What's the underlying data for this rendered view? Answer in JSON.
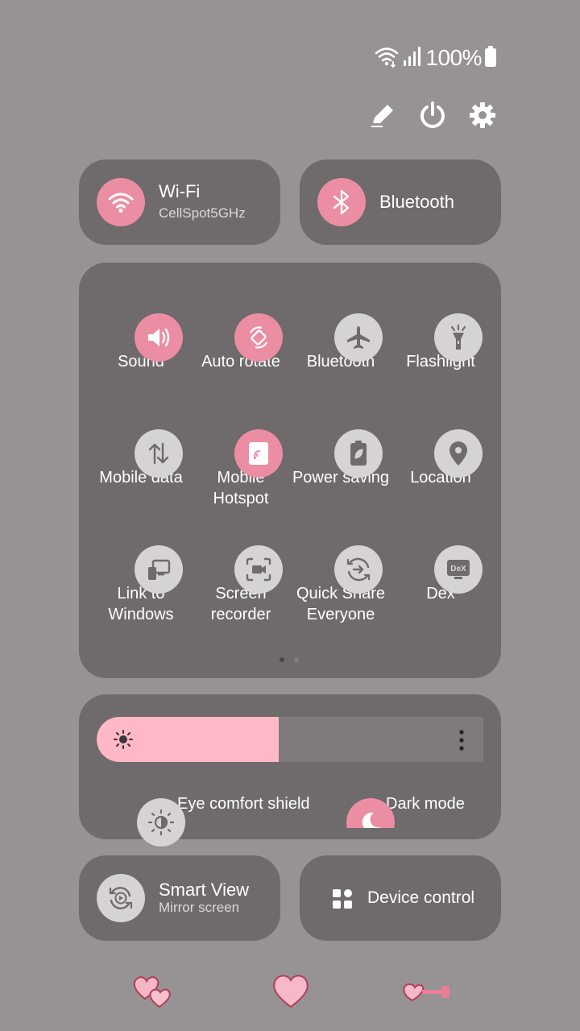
{
  "status_bar": {
    "battery_text": "100%",
    "icons": [
      "wifi-icon",
      "signal-icon",
      "battery-icon"
    ]
  },
  "top_actions": [
    "edit-icon",
    "power-icon",
    "settings-icon"
  ],
  "wifi": {
    "title": "Wi-Fi",
    "subtitle": "CellSpot5GHz"
  },
  "bluetooth_card": {
    "title": "Bluetooth"
  },
  "tiles": [
    {
      "label": "Sound",
      "icon": "sound-icon",
      "active": true
    },
    {
      "label": "Auto rotate",
      "icon": "auto-rotate-icon",
      "active": true
    },
    {
      "label": "Bluetooth",
      "icon": "airplane-icon",
      "active": false
    },
    {
      "label": "Flashlight",
      "icon": "flashlight-icon",
      "active": false
    },
    {
      "label": "Mobile data",
      "icon": "mobile-data-icon",
      "active": false
    },
    {
      "label": "Mobile Hotspot",
      "icon": "hotspot-icon",
      "active": true
    },
    {
      "label": "Power saving",
      "icon": "power-saving-icon",
      "active": false
    },
    {
      "label": "Location",
      "icon": "location-icon",
      "active": false
    },
    {
      "label": "Link to Windows",
      "icon": "link-to-windows-icon",
      "active": false
    },
    {
      "label": "Screen recorder",
      "icon": "screen-recorder-icon",
      "active": false
    },
    {
      "label": "Quick Share Everyone",
      "icon": "quick-share-icon",
      "active": false
    },
    {
      "label": "Dex",
      "icon": "dex-icon",
      "active": false
    }
  ],
  "brightness": {
    "level_fraction": 0.47
  },
  "eye_comfort": {
    "label": "Eye comfort shield"
  },
  "dark_mode": {
    "label": "Dark mode"
  },
  "smart_view": {
    "title": "Smart View",
    "subtitle": "Mirror screen"
  },
  "device_control": {
    "title": "Device control"
  },
  "colors": {
    "accent": "#ec8ea3",
    "card": "#6f6a6b",
    "background": "#979394",
    "slider_fill": "#ffb8c6"
  }
}
